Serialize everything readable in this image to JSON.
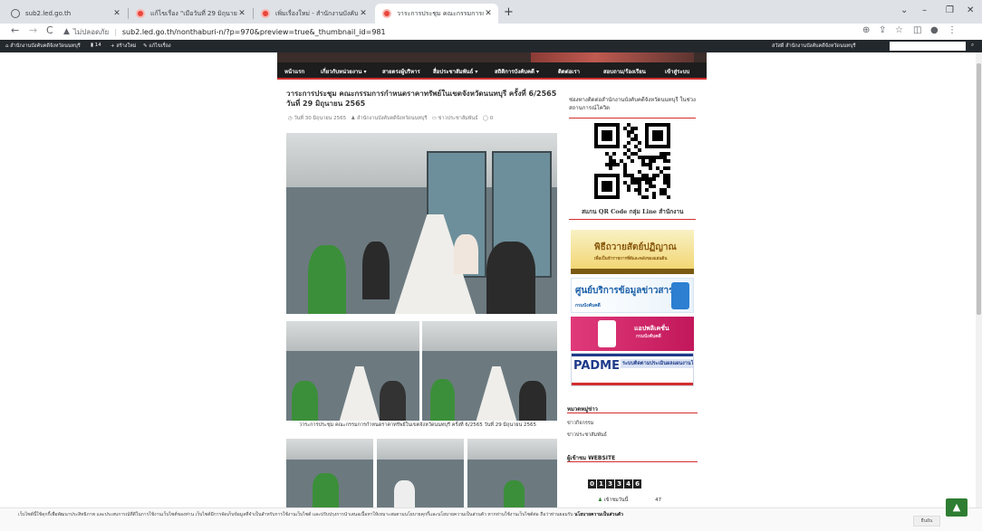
{
  "browser": {
    "tabs": [
      {
        "title": "sub2.led.go.th",
        "active": false
      },
      {
        "title": "แก้ไขเรื่อง \"เมือวันที่ 29 มิถุนายน 25…\"",
        "active": false
      },
      {
        "title": "เพิ่มเรื่องใหม่ - สำนักงานบังคับคดีจังหวั…",
        "active": false
      },
      {
        "title": "วาระการประชุม คณะกรรมการกำหนดร…",
        "active": true
      }
    ],
    "new_tab": "+",
    "window_controls": [
      "⌄",
      "–",
      "❐",
      "✕"
    ],
    "address": {
      "security_label": "ไม่ปลอดภัย",
      "url": "sub2.led.go.th/nonthaburi-n/?p=970&preview=true&_thumbnail_id=981"
    },
    "nav": {
      "back": "←",
      "forward": "→",
      "reload": "C"
    },
    "right_icons": [
      "⊕",
      "⇪",
      "☆",
      "◫",
      "●",
      "⋮"
    ]
  },
  "adminbar": {
    "site_name": "สำนักงานบังคับคดีจังหวัดนนทบุรี",
    "comments_count": "14",
    "new_label": "สร้างใหม่",
    "edit_label": "แก้ไขเรื่อง",
    "account_label": "สวัสดี สำนักงานบังคับคดีจังหวัดนนทบุรี"
  },
  "menu": {
    "items": [
      "หน้าแรก",
      "เกี่ยวกับหน่วยงาน ▾",
      "สายตรงผู้บริหาร",
      "สื่อประชาสัมพันธ์ ▾",
      "สถิติการบังคับคดี ▾",
      "ติดต่อเรา",
      "สอบถาม/ร้องเรียน",
      "เข้าสู่ระบบ"
    ]
  },
  "post": {
    "title": "วาระการประชุม คณะกรรมการกำหนดราคาทรัพย์ในเขตจังหวัดนนทบุรี ครั้งที่ 6/2565 วันที่ 29 มิถุนายน 2565",
    "date": "วันที่ 30 มิถุนายน 2565",
    "author": "สำนักงานบังคับคดีจังหวัดนนทบุรี",
    "category": "ข่าวประชาสัมพันธ์",
    "comments": "0",
    "caption": "วาระการประชุม คณะกรรมการกำหนดราคาทรัพย์ในเขตจังหวัดนนทบุรี ครั้งที่ 6/2565 วันที่ 29 มิถุนายน 2565"
  },
  "sidebar": {
    "line_heading": "ช่องทางติดต่อสำนักงานบังคับคดีจังหวัดนนทบุรี ในช่วงสถานการณ์โควิด",
    "qr_caption": "สแกน QR Code กลุ่ม Line สำนักงาน",
    "ads": [
      {
        "title": "พิธีถวายสัตย์ปฏิญาณ",
        "subtitle": "เพื่อเป็นข้าราชการที่ดีและพลังของแผ่นดิน"
      },
      {
        "title": "ศูนย์บริการข้อมูลข่าวสาร",
        "subtitle": "กรมบังคับคดี"
      },
      {
        "title": "แอปพลิเคชั่น",
        "subtitle": "กรมบังคับคดี"
      },
      {
        "title": "PADME",
        "subtitle": "ระบบติดตามประเมินผลแผนงานโครงการ"
      }
    ],
    "news_heading": "หมวดหมู่ข่าว",
    "categories": [
      "ข่าวกิจกรรม",
      "ข่าวประชาสัมพันธ์"
    ],
    "visitors_heading": "ผู้เข้าชม WEBSITE",
    "counter_digits": [
      "0",
      "1",
      "3",
      "3",
      "4",
      "6"
    ],
    "visits_label": "เข้าชมวันนี้",
    "visits_value": "47"
  },
  "cookie": {
    "text": "เว็บไซต์นี้ใช้คุกกี้เพื่อพัฒนาประสิทธิภาพ และประสบการณ์ที่ดีในการใช้งานเว็บไซต์ของท่าน เว็บไซต์มีการจัดเก็บข้อมูลที่จำเป็นสำหรับการใช้งานเว็บไซต์ และปรับปรุงการนำเสนอเนื้อหาให้เหมาะสมตามนโยบายคุกกี้และนโยบายความเป็นส่วนตัว หากท่านใช้งานเว็บไซต์ต่อ ถือว่าท่านยอมรับ",
    "link": "นโยบายความเป็นส่วนตัว",
    "accept": "ยืนยัน"
  },
  "colors": {
    "accent": "#d32f2f",
    "menu_bg": "#1d1d1d",
    "adminbar_bg": "#23282d",
    "totop": "#2e7d32"
  }
}
